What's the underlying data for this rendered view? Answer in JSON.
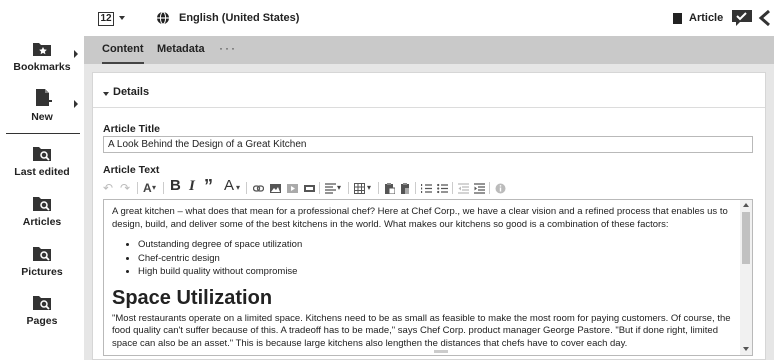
{
  "sidebar": {
    "items": [
      {
        "label": "Bookmarks",
        "icon": "bookmark-folder-icon"
      },
      {
        "label": "New",
        "icon": "new-document-icon"
      },
      {
        "label": "Last edited",
        "icon": "search-folder-icon"
      },
      {
        "label": "Articles",
        "icon": "search-folder-icon"
      },
      {
        "label": "Pictures",
        "icon": "search-folder-icon"
      },
      {
        "label": "Pages",
        "icon": "search-folder-icon"
      }
    ]
  },
  "topbar": {
    "view_number": "12",
    "language": "English (United States)",
    "content_type": "Article"
  },
  "tabs": [
    {
      "label": "Content",
      "active": true
    },
    {
      "label": "Metadata",
      "active": false
    }
  ],
  "tabs_more": "···",
  "details": {
    "section_title": "Details",
    "article_title_label": "Article Title",
    "article_title_value": "A Look Behind the Design of a Great Kitchen",
    "article_text_label": "Article Text"
  },
  "toolbar": {
    "font_size_glyph": "A",
    "bold_glyph": "B",
    "italic_glyph": "I",
    "quote_glyph": "”",
    "font_color_glyph": "A"
  },
  "editor": {
    "intro": "A great kitchen – what does that mean for a professional chef? Here at Chef Corp., we have a clear vision and a refined process that enables us to design, build, and deliver some of the best kitchens in the world. What makes our kitchens so good is a combination of these factors:",
    "bullets": [
      "Outstanding degree of space utilization",
      "Chef-centric design",
      "High build quality without compromise"
    ],
    "heading": "Space Utilization",
    "paragraph": "\"Most restaurants operate on a limited space. Kitchens need to be as small as feasible to make the most room for paying customers. Of course, the food quality can't suffer because of this. A tradeoff has to be made,\" says Chef Corp. product manager George Pastore. \"But if done right, limited space can also be an asset.\" This is because large kitchens also lengthen the distances that chefs have to cover each day."
  },
  "colors": {
    "tabs_bar": "#c9c9c9",
    "main_background": "#e6e6e6",
    "accent_text": "#222222"
  }
}
